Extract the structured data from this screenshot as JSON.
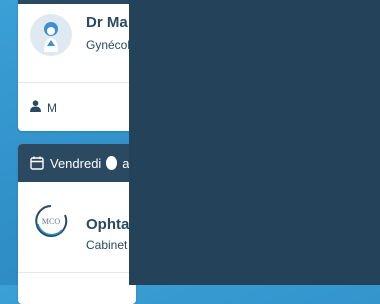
{
  "appointments": [
    {
      "date_label": "",
      "doctor_name": "Dr Ma",
      "specialty": "Gynécolo",
      "patient_label": "M",
      "avatar_icon": "doctor-avatar-icon",
      "patient_icon": "person-icon"
    },
    {
      "date_label": "Vendredi",
      "date_suffix": "ac",
      "doctor_name": "Ophta",
      "specialty": "Cabinet",
      "logo_text": "MCO",
      "date_icon": "calendar-icon"
    }
  ],
  "colors": {
    "header": "#2b4a61",
    "overlay": "#24435a",
    "background": "#2f8fc7"
  }
}
